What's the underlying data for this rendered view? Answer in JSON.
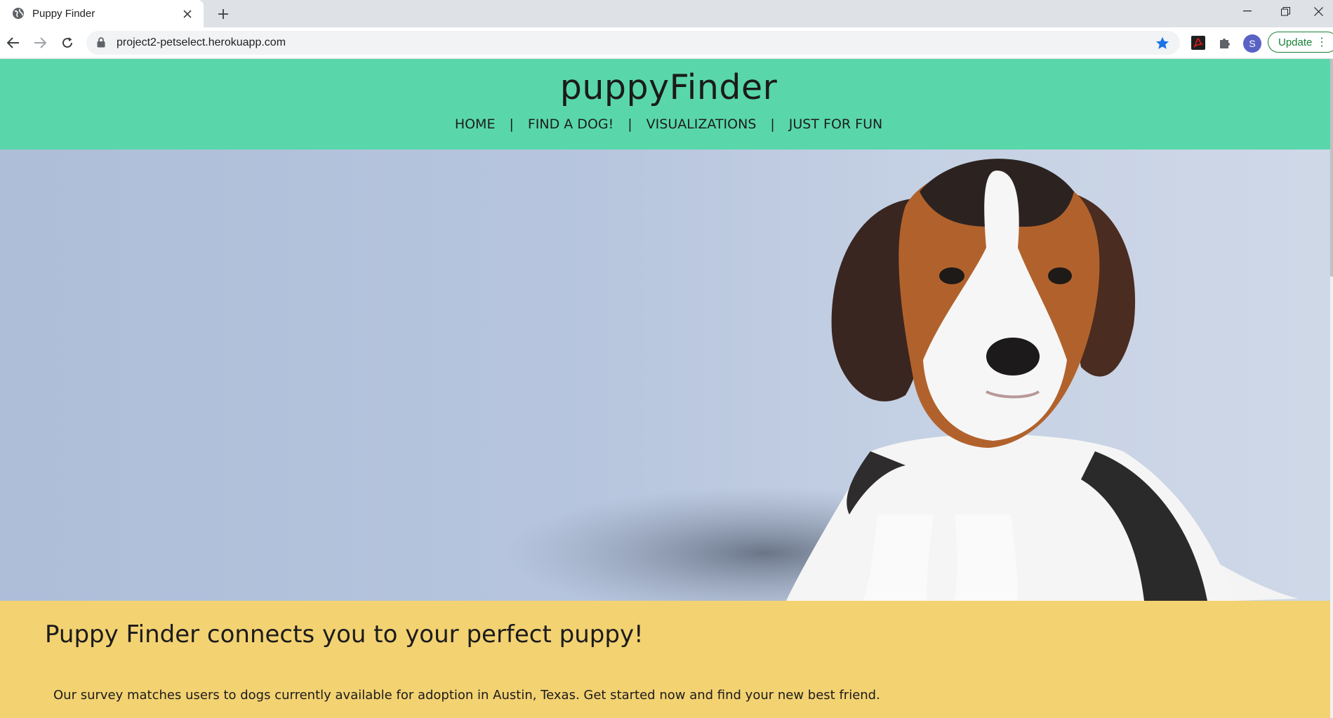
{
  "browser": {
    "tab_title": "Puppy Finder",
    "url": "project2-petselect.herokuapp.com",
    "profile_initial": "S",
    "update_label": "Update"
  },
  "site": {
    "brand": "puppyFinder",
    "nav": [
      {
        "label": "HOME"
      },
      {
        "label": "FIND A DOG!"
      },
      {
        "label": "VISUALIZATIONS"
      },
      {
        "label": "JUST FOR FUN"
      }
    ],
    "hero_image": "beagle-puppy-photo",
    "headline": "Puppy Finder connects you to your perfect puppy!",
    "intro": "Our survey matches users to dogs currently available for adoption in Austin, Texas. Get started now and find your new best friend.",
    "colors": {
      "header_bg": "#59d7ab",
      "about_bg": "#f3d272"
    }
  }
}
